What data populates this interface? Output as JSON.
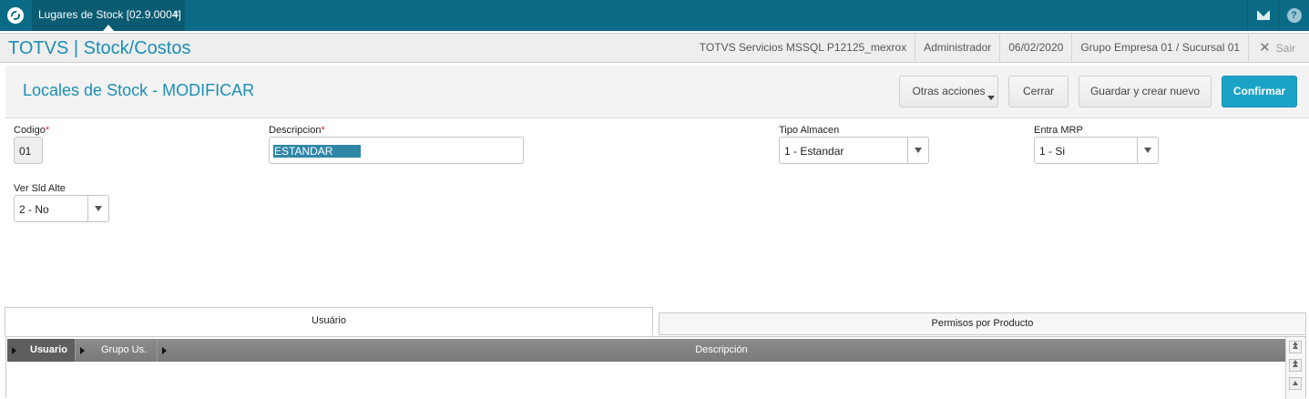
{
  "topbar": {
    "tab_label": "Lugares de Stock [02.9.0004]",
    "tab_close": "×",
    "help_glyph": "?"
  },
  "app": {
    "title": "TOTVS | Stock/Costos",
    "environment": "TOTVS Servicios MSSQL P12125_mexrox",
    "user": "Administrador",
    "date": "06/02/2020",
    "company": "Grupo Empresa 01 / Sucursal 01",
    "logout_label": "Sair",
    "logout_icon": "✕"
  },
  "form": {
    "title": "Locales de Stock - MODIFICAR",
    "actions": {
      "otras": "Otras acciones",
      "cerrar": "Cerrar",
      "guardar": "Guardar y crear nuevo",
      "confirmar": "Confirmar"
    },
    "fields": {
      "codigo": {
        "label": "Codigo",
        "required_mark": "*",
        "value": "01"
      },
      "descripcion": {
        "label": "Descripcion",
        "required_mark": "*",
        "value": "ESTANDAR"
      },
      "tipo_almacen": {
        "label": "Tipo Almacen",
        "value": "1 - Estandar"
      },
      "entra_mrp": {
        "label": "Entra MRP",
        "value": "1 - Si"
      },
      "ver_sld_alte": {
        "label": "Ver Sld Alte",
        "value": "2 - No"
      }
    }
  },
  "tabs": [
    {
      "label": "Usuário",
      "active": true
    },
    {
      "label": "Permisos por Producto",
      "active": false
    }
  ],
  "grid": {
    "columns": [
      "Usuario",
      "Grupo Us.",
      "Descripción"
    ],
    "rows": []
  },
  "colors": {
    "topbar": "#0b6b86",
    "accent": "#1b8fb4",
    "primary_button": "#1ba3c6",
    "required": "#e0232e"
  }
}
